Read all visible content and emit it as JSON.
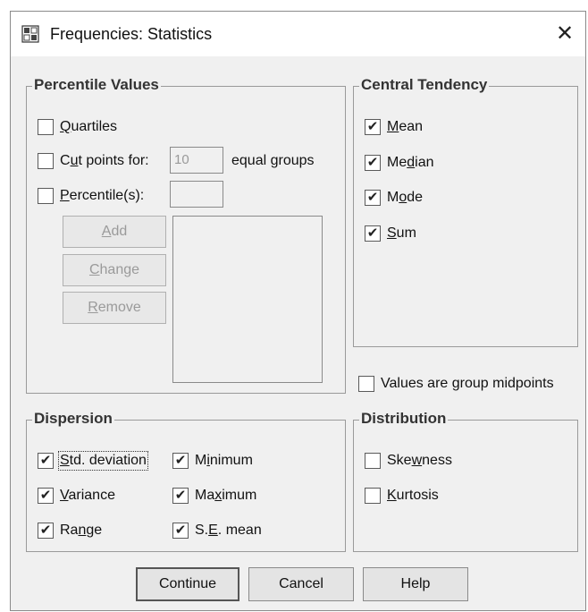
{
  "window": {
    "title": "Frequencies: Statistics",
    "close_glyph": "✕"
  },
  "percentile": {
    "legend": "Percentile Values",
    "quartiles": {
      "pre": "",
      "key": "Q",
      "post": "uartiles",
      "checked": false
    },
    "cutpoints": {
      "pre": "C",
      "key": "u",
      "post": "t points for:",
      "checked": false,
      "value": "10",
      "suffix": "equal groups"
    },
    "percentiles": {
      "pre": "",
      "key": "P",
      "post": "ercentile(s):",
      "checked": false,
      "value": ""
    },
    "add": {
      "pre": "",
      "key": "A",
      "post": "dd"
    },
    "change": {
      "pre": "",
      "key": "C",
      "post": "hange"
    },
    "remove": {
      "pre": "",
      "key": "R",
      "post": "emove"
    }
  },
  "central": {
    "legend": "Central Tendency",
    "mean": {
      "pre": "",
      "key": "M",
      "post": "ean",
      "checked": true
    },
    "median": {
      "pre": "Me",
      "key": "d",
      "post": "ian",
      "checked": true
    },
    "mode": {
      "pre": "M",
      "key": "o",
      "post": "de",
      "checked": true
    },
    "sum": {
      "pre": "",
      "key": "S",
      "post": "um",
      "checked": true
    }
  },
  "midpoints": {
    "label": "Values are group midpoints",
    "checked": false
  },
  "dispersion": {
    "legend": "Dispersion",
    "std": {
      "pre": "",
      "key": "S",
      "post": "td. deviation",
      "checked": true
    },
    "variance": {
      "pre": "",
      "key": "V",
      "post": "ariance",
      "checked": true
    },
    "range": {
      "pre": "Ra",
      "key": "n",
      "post": "ge",
      "checked": true
    },
    "minimum": {
      "pre": "M",
      "key": "i",
      "post": "nimum",
      "checked": true
    },
    "maximum": {
      "pre": "Ma",
      "key": "x",
      "post": "imum",
      "checked": true
    },
    "semean": {
      "pre": "S.",
      "key": "E",
      "post": ". mean",
      "checked": true
    }
  },
  "distribution": {
    "legend": "Distribution",
    "skewness": {
      "pre": "Ske",
      "key": "w",
      "post": "ness",
      "checked": false
    },
    "kurtosis": {
      "pre": "",
      "key": "K",
      "post": "urtosis",
      "checked": false
    }
  },
  "buttons": {
    "continue": "Continue",
    "cancel": "Cancel",
    "help": "Help"
  },
  "check_glyph": "✔"
}
